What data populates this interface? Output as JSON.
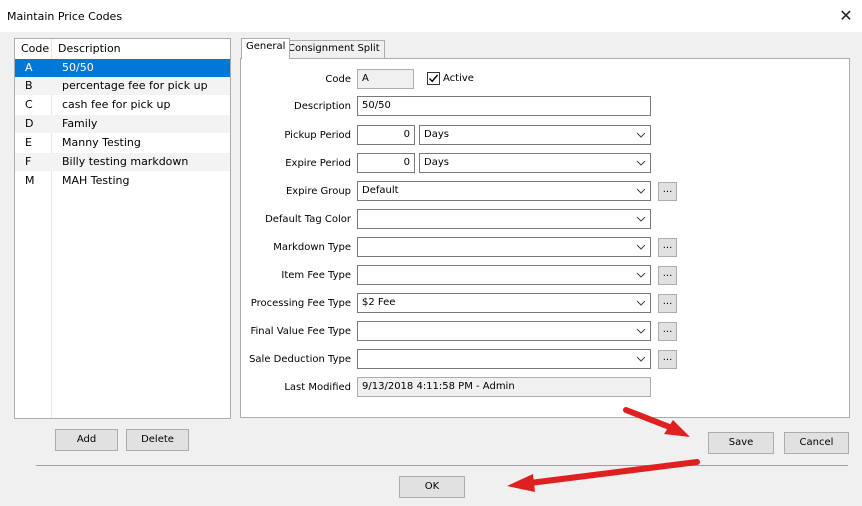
{
  "window": {
    "title": "Maintain Price Codes",
    "close_glyph": "✕"
  },
  "price_codes": {
    "headers": {
      "code": "Code",
      "description": "Description"
    },
    "rows": [
      {
        "code": "A",
        "description": "50/50"
      },
      {
        "code": "B",
        "description": "percentage fee for pick up"
      },
      {
        "code": "C",
        "description": "cash fee for pick up"
      },
      {
        "code": "D",
        "description": "Family"
      },
      {
        "code": "E",
        "description": "Manny Testing"
      },
      {
        "code": "F",
        "description": "Billy testing markdown"
      },
      {
        "code": "M",
        "description": "MAH Testing"
      }
    ],
    "selected_index": 0
  },
  "tabs": [
    "General",
    "Consignment Split"
  ],
  "form": {
    "code_label": "Code",
    "code_value": "A",
    "active_label": "Active",
    "active_checked": true,
    "description_label": "Description",
    "description_value": "50/50",
    "pickup_label": "Pickup Period",
    "pickup_value": "0",
    "pickup_unit": "Days",
    "expire_label": "Expire Period",
    "expire_value": "0",
    "expire_unit": "Days",
    "expire_group_label": "Expire Group",
    "expire_group_value": "Default",
    "tag_color_label": "Default Tag Color",
    "tag_color_value": "",
    "markdown_label": "Markdown Type",
    "markdown_value": "",
    "item_fee_label": "Item Fee Type",
    "item_fee_value": "",
    "processing_fee_label": "Processing Fee Type",
    "processing_fee_value": "$2 Fee",
    "final_value_label": "Final Value Fee Type",
    "final_value_value": "",
    "sale_deduction_label": "Sale Deduction Type",
    "sale_deduction_value": "",
    "last_modified_label": "Last Modified",
    "last_modified_value": "9/13/2018 4:11:58 PM - Admin",
    "ellipsis": "..."
  },
  "buttons": {
    "add": "Add",
    "delete": "Delete",
    "save": "Save",
    "cancel": "Cancel",
    "ok": "OK"
  },
  "colors": {
    "selection": "#0078d7",
    "annotation_arrow": "#e02020"
  }
}
